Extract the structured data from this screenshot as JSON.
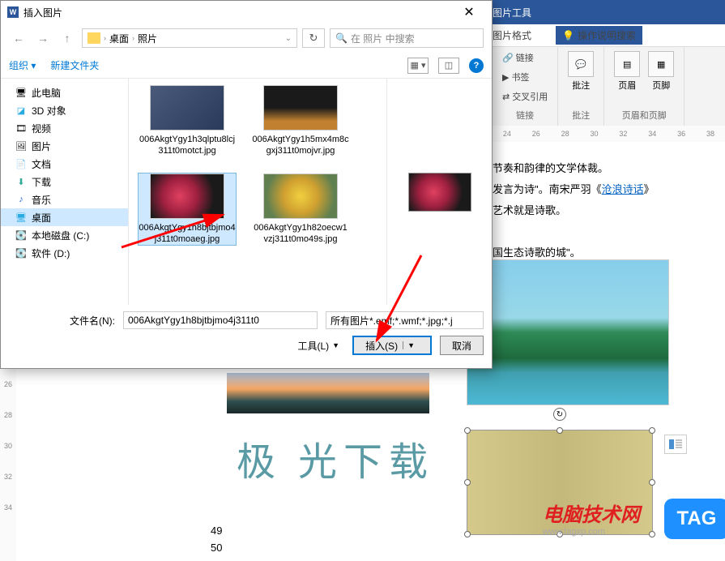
{
  "word": {
    "ribbon_tab1": "图片工具",
    "ribbon_tab2": "图片格式",
    "help_text": "操作说明搜索",
    "links_group": {
      "link": "链接",
      "bookmark": "书签",
      "crossref": "交叉引用",
      "label": "链接"
    },
    "annotate_group": {
      "btn": "批注",
      "label": "批注"
    },
    "header_footer_group": {
      "header": "页眉",
      "footer": "页脚",
      "label": "页眉和页脚"
    },
    "ruler_h": [
      "24",
      "26",
      "28",
      "30",
      "32",
      "34",
      "36",
      "38"
    ],
    "ruler_v": [
      "26",
      "28",
      "30",
      "32",
      "34"
    ]
  },
  "doc": {
    "line1": "节奏和韵律的文学体裁。",
    "line2a": "发言为诗\"。南宋严羽《",
    "line2_link": "沧浪诗话",
    "line2b": "》",
    "line3": "艺术就是诗歌。",
    "line4": "国生态诗歌的城\"。",
    "watermark": "极  光下载",
    "num1": "49",
    "num2": "50",
    "brand": "电脑技术网",
    "brand_url": "www.tagxp.com",
    "tag": "TAG"
  },
  "dlg": {
    "title": "插入图片",
    "bc1": "桌面",
    "bc2": "照片",
    "search_placeholder": "在 照片 中搜索",
    "organize": "组织",
    "new_folder": "新建文件夹",
    "tree": {
      "this_pc": "此电脑",
      "objects_3d": "3D 对象",
      "videos": "视频",
      "pictures": "图片",
      "documents": "文档",
      "downloads": "下载",
      "music": "音乐",
      "desktop": "桌面",
      "local_c": "本地磁盘 (C:)",
      "soft_d": "软件 (D:)"
    },
    "files": {
      "f1": "006AkgtYgy1h3qlptu8lcj311t0motct.jpg",
      "f2": "006AkgtYgy1h5mx4m8cgxj311t0mojvr.jpg",
      "f3": "006AkgtYgy1h8bjtbjmo4j311t0moaeg.jpg",
      "f4": "006AkgtYgy1h82oecw1vzj311t0mo49s.jpg"
    },
    "fn_label": "文件名(N):",
    "fn_value": "006AkgtYgy1h8bjtbjmo4j311t0",
    "filter": "所有图片*.emf;*.wmf;*.jpg;*.j",
    "tools": "工具(L)",
    "insert": "插入(S)",
    "cancel": "取消"
  }
}
